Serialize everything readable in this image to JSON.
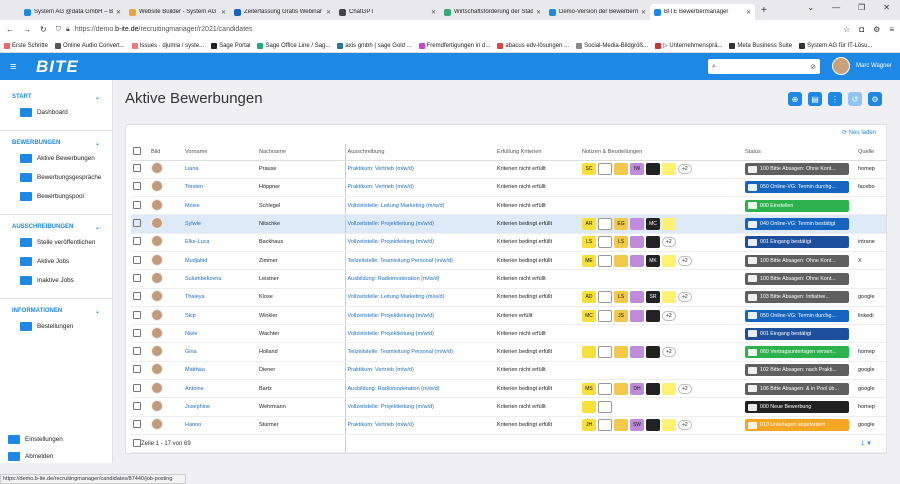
{
  "browser": {
    "tabs": [
      {
        "label": "System AG @data GmbH – B-ite",
        "color": "#1e88e5"
      },
      {
        "label": "Website Builder - System AG @...",
        "color": "#e8a33a"
      },
      {
        "label": "Zeiterfassung Gratis Webinar | ...",
        "color": "#1565c0"
      },
      {
        "label": "ChatGPT",
        "color": "#444"
      },
      {
        "label": "Wirtschaftsförderung der Stadt...",
        "color": "#3a7"
      },
      {
        "label": "Demo-Version der Bewerberma...",
        "color": "#1e88e5"
      },
      {
        "label": "BITE Bewerbermanager",
        "color": "#1e88e5",
        "active": true
      }
    ],
    "url_prefix": "https://demo.",
    "url_domain": "b-ite.de",
    "url_path": "/recruitingmanager/r2021/candidates",
    "bookmarks": [
      {
        "label": "Erste Schritte",
        "color": "#e66"
      },
      {
        "label": "Online Audio Convert...",
        "color": "#555"
      },
      {
        "label": "Issues · djumla / syste...",
        "color": "#e77"
      },
      {
        "label": "Sage Portal",
        "color": "#222"
      },
      {
        "label": "Sage Office Line / Sag...",
        "color": "#2a8"
      },
      {
        "label": "axis gmbh | sage Gold ...",
        "color": "#27a"
      },
      {
        "label": "Fremdfertigungen in d...",
        "color": "#c4c"
      },
      {
        "label": "abacus edv-lösungen ...",
        "color": "#d44"
      },
      {
        "label": "Social-Media-Bildgröß...",
        "color": "#888"
      },
      {
        "label": "▷ Unternehmensprä...",
        "color": "#c33"
      },
      {
        "label": "Meta Business Suite",
        "color": "#333"
      },
      {
        "label": "System AG für IT-Lösu...",
        "color": "#333"
      }
    ],
    "status_url": "https://demo.b-ite.de/recruitingmanager/candidates/87440/job-posting"
  },
  "header": {
    "logo": "BITE",
    "search_placeholder": "",
    "user": "Marc Wagner"
  },
  "sidebar": {
    "sections": [
      {
        "title": "START",
        "items": [
          "Dashboard"
        ]
      },
      {
        "title": "BEWERBUNGEN",
        "items": [
          "Aktive Bewerbungen",
          "Bewerbungsgespräche",
          "Bewerbungspool"
        ]
      },
      {
        "title": "AUSSCHREIBUNGEN",
        "items": [
          "Stelle veröffentlichen",
          "Aktive Jobs",
          "Inaktive Jobs"
        ]
      },
      {
        "title": "INFORMATIONEN",
        "items": [
          "Bestellungen"
        ]
      }
    ],
    "footer": [
      "Einstellungen",
      "Abmelden"
    ]
  },
  "page": {
    "title": "Aktive Bewerbungen",
    "reload_label": "Neu laden",
    "footer_text": "Zeile 1 - 17 von 69",
    "footer_right": "1"
  },
  "table": {
    "columns": [
      "",
      "Bild",
      "Vorname",
      "Nachname",
      "Ausschreibung",
      "Erfüllung Kriterien",
      "Notizen & Beurteilungen",
      "Status",
      "Quelle"
    ],
    "rows": [
      {
        "first": "Liana",
        "last": "Prause",
        "job": "Praktikum: Vertrieb (m/w/d)",
        "crit": "Kriterien nicht erfüllt",
        "badges": [
          "SC",
          "",
          "",
          "IW",
          "",
          ""
        ],
        "more": "+2",
        "status": "100 Bitte Absagen: Ohne Kont...",
        "scolor": "#5f5f5f",
        "src": "homep"
      },
      {
        "first": "Torsten",
        "last": "Höppner",
        "job": "Praktikum: Vertrieb (m/w/d)",
        "crit": "Kriterien nicht erfüllt",
        "badges": [],
        "more": "",
        "status": "050 Online-VG: Termin durchg...",
        "scolor": "#1565c0",
        "src": "facebo"
      },
      {
        "first": "Moise",
        "last": "Schlegel",
        "job": "Vollzeitstelle: Leitung Marketing (m/w/d)",
        "crit": "Kriterien nicht erfüllt",
        "badges": [],
        "more": "",
        "status": "000 Einstellen",
        "scolor": "#2bb24c",
        "src": ""
      },
      {
        "first": "Sylwie",
        "last": "Nitschke",
        "job": "Vollzeitstelle: Projektleitung (m/w/d)",
        "crit": "Kriterien bedingt erfüllt",
        "badges": [
          "AR",
          "",
          "EG",
          "",
          "MC",
          ""
        ],
        "more": "",
        "status": "040 Online-VG: Termin bestätigt",
        "scolor": "#1565c0",
        "src": "",
        "hl": true
      },
      {
        "first": "Elke-Luca",
        "last": "Backhaus",
        "job": "Vollzeitstelle: Projektleitung (m/w/d)",
        "crit": "Kriterien bedingt erfüllt",
        "badges": [
          "LS",
          "",
          "LS",
          "",
          ""
        ],
        "more": "+2",
        "status": "001 Eingang bestätigt",
        "scolor": "#1e4f9c",
        "src": "intrane"
      },
      {
        "first": "Mudjahid",
        "last": "Zimmer",
        "job": "Teilzeitstelle: Teamleitung Personal (m/w/d)",
        "crit": "Kriterien bedingt erfüllt",
        "badges": [
          "ME",
          "",
          "",
          "",
          "MK",
          ""
        ],
        "more": "+2",
        "status": "100 Bitte Absagen: Ohne Kont...",
        "scolor": "#5f5f5f",
        "src": "X"
      },
      {
        "first": "Sulumbekovna",
        "last": "Leistner",
        "job": "Ausbildung: Radiomoderation (m/w/d)",
        "crit": "Kriterien nicht erfüllt",
        "badges": [],
        "more": "",
        "status": "100 Bitte Absagen: Ohne Kont...",
        "scolor": "#5f5f5f",
        "src": ""
      },
      {
        "first": "Thaleya",
        "last": "Klose",
        "job": "Vollzeitstelle: Leitung Marketing (m/w/d)",
        "crit": "Kriterien bedingt erfüllt",
        "badges": [
          "AD",
          "",
          "LS",
          "",
          "SR",
          ""
        ],
        "more": "+2",
        "status": "103 Bitte Absagen: Initiative...",
        "scolor": "#5f5f5f",
        "src": "google"
      },
      {
        "first": "Skip",
        "last": "Winkler",
        "job": "Vollzeitstelle: Projektleitung (m/w/d)",
        "crit": "Kriterien erfüllt",
        "badges": [
          "MC",
          "",
          "JS",
          "",
          ""
        ],
        "more": "+2",
        "status": "050 Online-VG: Termin durchg...",
        "scolor": "#1565c0",
        "src": "linkedi"
      },
      {
        "first": "Niele",
        "last": "Wachter",
        "job": "Vollzeitstelle: Projektleitung (m/w/d)",
        "crit": "Kriterien nicht erfüllt",
        "badges": [],
        "more": "",
        "status": "001 Eingang bestätigt",
        "scolor": "#1e4f9c",
        "src": ""
      },
      {
        "first": "Gina",
        "last": "Holland",
        "job": "Teilzeitstelle: Teamleitung Personal (m/w/d)",
        "crit": "Kriterien bedingt erfüllt",
        "badges": [
          "",
          "",
          "",
          "",
          ""
        ],
        "more": "+2",
        "status": "060 Vertragsunterlagen versen...",
        "scolor": "#2bb24c",
        "src": "homep"
      },
      {
        "first": "Matthäa",
        "last": "Diener",
        "job": "Praktikum: Vertrieb (m/w/d)",
        "crit": "Kriterien nicht erfüllt",
        "badges": [],
        "more": "",
        "status": "102 Bitte Absagen: nach Prakti...",
        "scolor": "#5f5f5f",
        "src": "google"
      },
      {
        "first": "Antoine",
        "last": "Bartz",
        "job": "Ausbildung: Radiomoderation (m/w/d)",
        "crit": "Kriterien bedingt erfüllt",
        "badges": [
          "MS",
          "",
          "",
          "DH",
          "",
          ""
        ],
        "more": "+2",
        "status": "106 Bitte Absagen: & in Pool üb...",
        "scolor": "#5f5f5f",
        "src": "google"
      },
      {
        "first": "Josephine",
        "last": "Wehrmann",
        "job": "Vollzeitstelle: Projektleitung (m/w/d)",
        "crit": "Kriterien nicht erfüllt",
        "badges": [
          "",
          ""
        ],
        "more": "",
        "status": "000 Neue Bewerbung",
        "scolor": "#212121",
        "src": "homep"
      },
      {
        "first": "Hanno",
        "last": "Stürmer",
        "job": "Praktikum: Vertrieb (m/w/d)",
        "crit": "Kriterien bedingt erfüllt",
        "badges": [
          "JH",
          "",
          "",
          "SW",
          "",
          ""
        ],
        "more": "+2",
        "status": "010 Unterlagen angefordert",
        "scolor": "#f5a623",
        "src": "google"
      },
      {
        "first": "",
        "last": "",
        "job": "",
        "crit": "",
        "badges": [],
        "more": "",
        "status": "",
        "scolor": "",
        "src": ""
      }
    ]
  },
  "badge_colors": [
    "#f7e03c",
    "#ffffff",
    "#f2c94c",
    "#c08bd8",
    "#222222",
    "#fff176"
  ]
}
